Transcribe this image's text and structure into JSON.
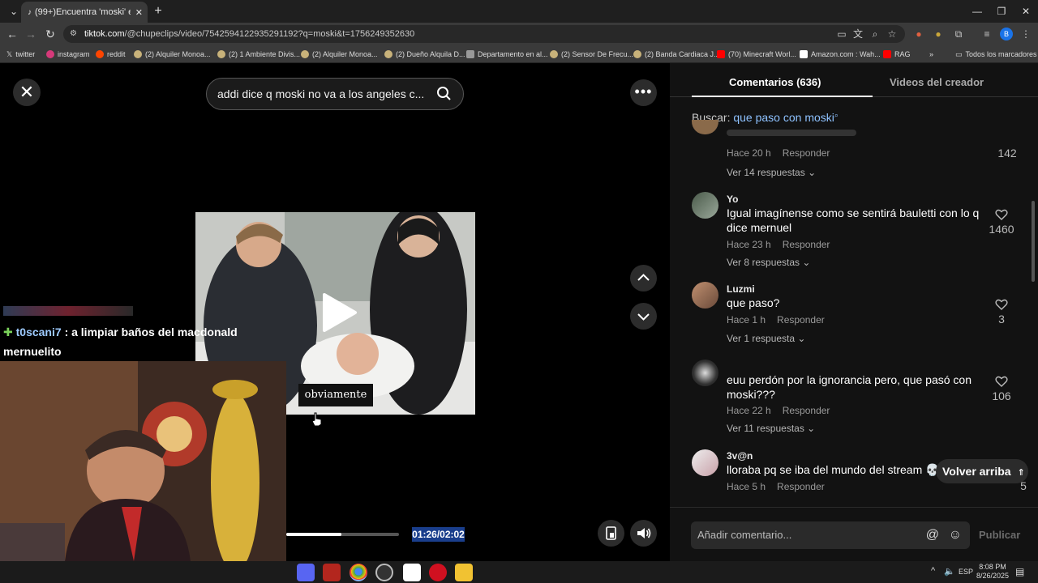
{
  "browser": {
    "tab_title": "(99+)Encuentra 'moski' en TikTo",
    "url_domain": "tiktok.com",
    "url_rest": "/@chupeclips/video/7542594122935291192?q=moski&t=1756249352630",
    "bookmarks": [
      "twitter",
      "instagram",
      "reddit",
      "(2) Alquiler Monoa...",
      "(2) 1 Ambiente Divis...",
      "(2) Alquiler Monoa...",
      "(2) Dueño Alquila D...",
      "Departamento en al...",
      "(2) Sensor De Frecu...",
      "(2) Banda Cardiaca J...",
      "(70) Minecraft Worl...",
      "Amazon.com : Wah...",
      "RAG",
      "Todos los marcadores"
    ]
  },
  "player": {
    "search_query": "addi dice q moski no va a los angeles c...",
    "caption": "obviamente",
    "time": "01:26/02:02",
    "progress": 0.49
  },
  "stream_overlay": {
    "chat_lines": [
      {
        "user": "t0scani7",
        "text": ": a limpiar baños del macdonald"
      },
      {
        "user": "",
        "text": "mernuelito"
      }
    ]
  },
  "comments_panel": {
    "tab_comments": "Comentarios (636)",
    "tab_creator": "Videos del creador",
    "search_label": "Buscar:",
    "search_term": "que paso con moski",
    "partial_top": {
      "time": "Hace 20 h",
      "reply": "Responder",
      "replies": "Ver 14 respuestas",
      "likes": "142"
    },
    "comments": [
      {
        "user": "Yo",
        "text": "Igual imagínense como se sentirá bauletti con lo q dice mernuel",
        "time": "Hace 23 h",
        "reply": "Responder",
        "replies": "Ver 8 respuestas",
        "likes": "1460"
      },
      {
        "user": "Luzmi",
        "text": "que paso?",
        "time": "Hace 1 h",
        "reply": "Responder",
        "replies": "Ver 1 respuesta",
        "likes": "3"
      },
      {
        "user": "",
        "text": "euu perdón por la ignorancia pero, que pasó con moski???",
        "time": "Hace 22 h",
        "reply": "Responder",
        "replies": "Ver 11 respuestas",
        "likes": "106"
      },
      {
        "user": "3v@n",
        "text": "lloraba pq se iba del mundo del stream 💀",
        "time": "Hace 5 h",
        "reply": "Responder",
        "replies": "",
        "likes": "5"
      }
    ],
    "back_to_top": "Volver arriba",
    "add_comment_placeholder": "Añadir comentario...",
    "publish": "Publicar"
  },
  "taskbar": {
    "lang": "ESP",
    "time": "8:08 PM",
    "date": "8/26/2025"
  },
  "colors": {
    "link_blue": "#8ec2ff",
    "timecode_bg": "#1a3e8c",
    "panel_bg": "#121212"
  }
}
